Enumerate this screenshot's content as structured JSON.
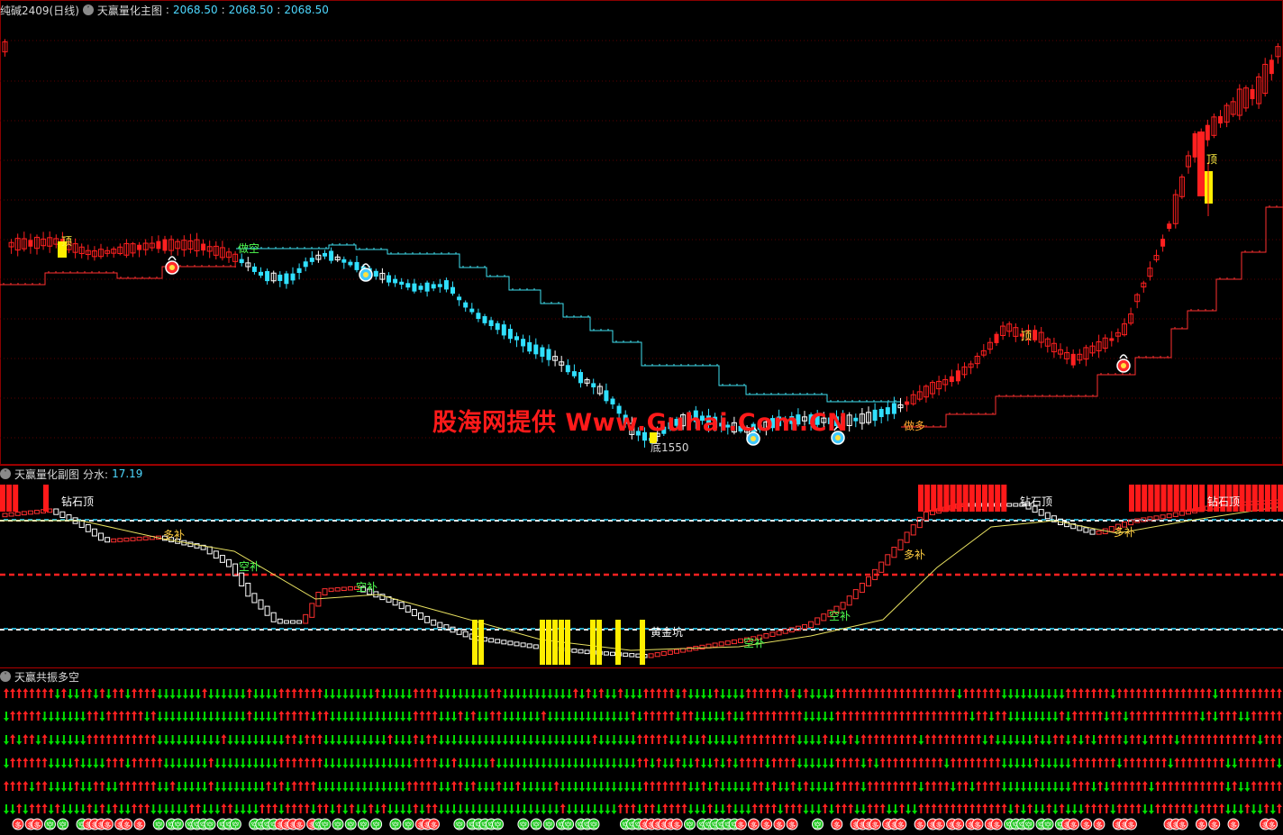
{
  "main_panel": {
    "symbol": "纯碱2409(日线)",
    "indicator_name": "天赢量化主图",
    "values": [
      "2068.50",
      "2068.50",
      "2068.50"
    ],
    "annotations": {
      "top_1": "顶",
      "top_2": "顶",
      "top_3": "顶",
      "short": "做空",
      "long": "做多",
      "bottom": "底1550"
    }
  },
  "sub_panel": {
    "indicator_name": "天赢量化副图",
    "value_label": "分水:",
    "value": "17.19",
    "annotations": {
      "diamond_top_1": "钻石顶",
      "diamond_top_2": "钻石顶",
      "diamond_top_3": "钻石顶",
      "long_add_1": "多补",
      "long_add_2": "多补",
      "long_add_3": "多补",
      "short_add_1": "空补",
      "short_add_2": "空补",
      "short_add_3": "空补",
      "short_add_4": "空补",
      "golden_pit": "黄金坑"
    }
  },
  "resonance_panel": {
    "indicator_name": "天赢共振多空",
    "badge_long": "多",
    "badge_short": "空"
  },
  "watermark": "股海网提供 Www.Guhai.Com.CN",
  "colors": {
    "up": "#ff2020",
    "down": "#30e0ff",
    "stop_red": "#ff3030",
    "stop_cyan": "#40e0f0",
    "yellow": "#ffee00",
    "arrow_red": "#ff2020",
    "arrow_green": "#00e000",
    "dash_cyan": "#30d8ff",
    "dash_white": "#ffffff",
    "dash_red": "#ff2020",
    "ma_yellow": "#e8e060"
  },
  "chart_data": [
    {
      "type": "candlestick",
      "title": "天赢量化主图",
      "series": [
        {
          "name": "纯碱2409(日线)",
          "kind": "ohlc",
          "note": "daily candles, rising from ~2070 range, falling to low 1550, rallying to ~2200+"
        }
      ],
      "annotated_low": 1550,
      "last_values": [
        "2068.50",
        "2068.50",
        "2068.50"
      ]
    },
    {
      "type": "bar",
      "title": "天赢量化副图",
      "value": 17.19,
      "reference_lines": [
        "cyan-upper",
        "red-middle",
        "cyan-lower"
      ]
    },
    {
      "type": "table",
      "title": "天赢共振多空",
      "rows": 6,
      "cell_kind": "arrow up (red) / arrow down (green)"
    }
  ]
}
